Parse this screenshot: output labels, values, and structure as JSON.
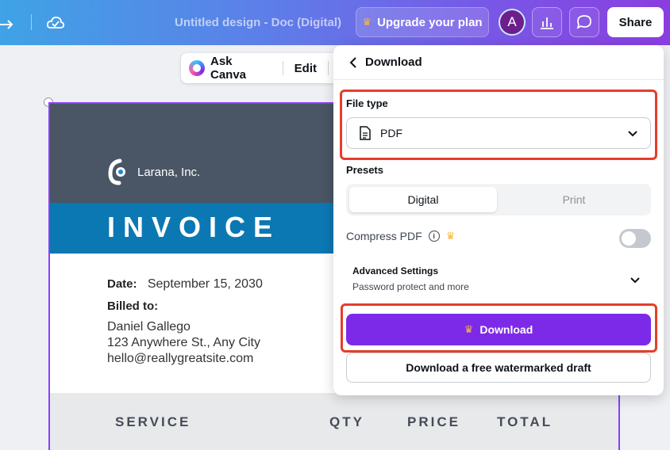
{
  "topbar": {
    "doc_title": "Untitled design - Doc (Digital)",
    "upgrade_label": "Upgrade your plan",
    "avatar_initial": "A",
    "share_label": "Share"
  },
  "context_toolbar": {
    "ask_label": "Ask Canva",
    "edit_label": "Edit"
  },
  "document": {
    "company": "Larana, Inc.",
    "title": "INVOICE",
    "date_label": "Date:",
    "date_value": "September 15, 2030",
    "billed_label": "Billed to:",
    "billed_name": "Daniel Gallego",
    "billed_address": "123 Anywhere St., Any City",
    "billed_email": "hello@reallygreatsite.com",
    "table_headers": [
      "SERVICE",
      "QTY",
      "PRICE",
      "TOTAL"
    ]
  },
  "download_panel": {
    "title": "Download",
    "file_type_label": "File type",
    "file_type_value": "PDF",
    "presets_label": "Presets",
    "presets": [
      "Digital",
      "Print"
    ],
    "presets_selected": "Digital",
    "compress_label": "Compress PDF",
    "compress_on": false,
    "advanced_title": "Advanced Settings",
    "advanced_subtitle": "Password protect and more",
    "download_label": "Download",
    "watermark_label": "Download a free watermarked draft"
  },
  "colors": {
    "accent": "#7d2ae8",
    "highlight": "#e53d2a",
    "invoice_dark": "#4a5565",
    "invoice_blue": "#0b78b3",
    "crown": "#f5b83d"
  }
}
